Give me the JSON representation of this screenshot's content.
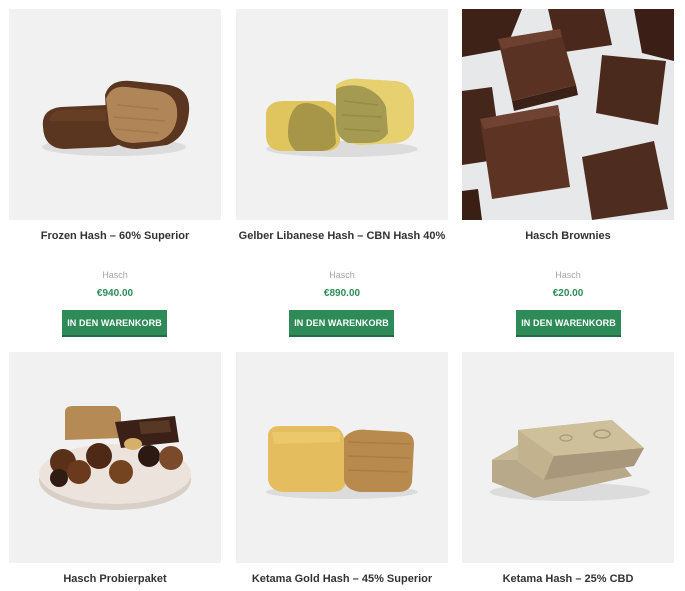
{
  "theme": {
    "accent": "#2e8b57",
    "price_color": "#2e8b57"
  },
  "products": [
    {
      "title": "Frozen Hash – 60% Superior",
      "category": "Hasch",
      "price": "€940.00",
      "button": "IN DEN WARENKORB",
      "image_icon": "frozen-hash-image"
    },
    {
      "title": "Gelber Libanese Hash – CBN Hash 40%",
      "category": "Hasch",
      "price": "€890.00",
      "button": "IN DEN WARENKORB",
      "image_icon": "gelber-libanese-hash-image"
    },
    {
      "title": "Hasch Brownies",
      "category": "Hasch",
      "price": "€20.00",
      "button": "IN DEN WARENKORB",
      "image_icon": "hasch-brownies-image"
    },
    {
      "title": "Hasch Probierpaket",
      "image_icon": "hasch-probierpaket-image"
    },
    {
      "title": "Ketama Gold Hash – 45% Superior",
      "image_icon": "ketama-gold-hash-image"
    },
    {
      "title": "Ketama Hash – 25% CBD",
      "image_icon": "ketama-hash-image"
    }
  ]
}
